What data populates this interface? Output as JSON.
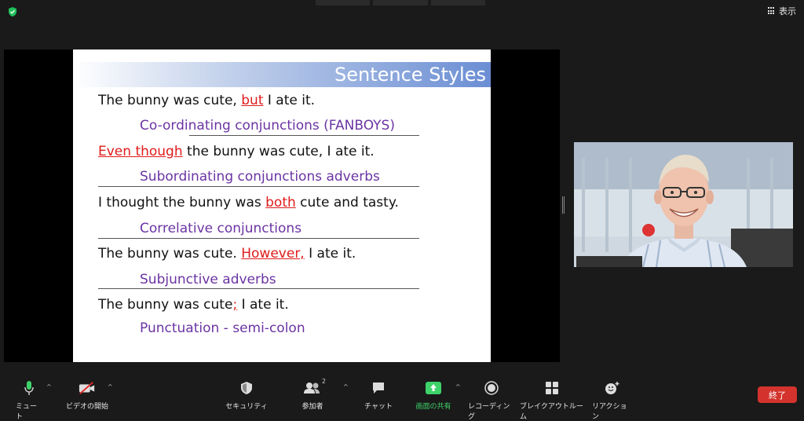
{
  "topbar": {
    "view_label": "表示"
  },
  "slide": {
    "title": "Sentence Styles",
    "rows": [
      {
        "pre": "The bunny was cute, ",
        "hl": "but",
        "post": " I ate it.",
        "label": "Co-ordinating conjunctions (FANBOYS)"
      },
      {
        "pre": "",
        "hl": "Even though",
        "post": " the bunny was cute, I ate it.",
        "label": "Subordinating conjunctions adverbs"
      },
      {
        "pre": "I thought the bunny was ",
        "hl": "both",
        "post": " cute and tasty.",
        "label": "Correlative conjunctions"
      },
      {
        "pre": "The bunny was cute. ",
        "hl": "However,",
        "post": " I ate it.",
        "label": "Subjunctive adverbs"
      },
      {
        "pre": "The bunny was cute",
        "hl": ";",
        "post": " I ate it.",
        "label": "Punctuation - semi-colon"
      }
    ]
  },
  "toolbar": {
    "mute": "ミュート",
    "video": "ビデオの開始",
    "security": "セキュリティ",
    "participants": "参加者",
    "participants_count": "2",
    "chat": "チャット",
    "share": "画面の共有",
    "record": "レコーディング",
    "breakout": "ブレイクアウトルーム",
    "reactions": "リアクション",
    "end": "終了"
  },
  "colors": {
    "share_green": "#3ed26a",
    "end_red": "#d3332c",
    "highlight_red": "#e01b1b",
    "label_purple": "#6b34a3"
  }
}
